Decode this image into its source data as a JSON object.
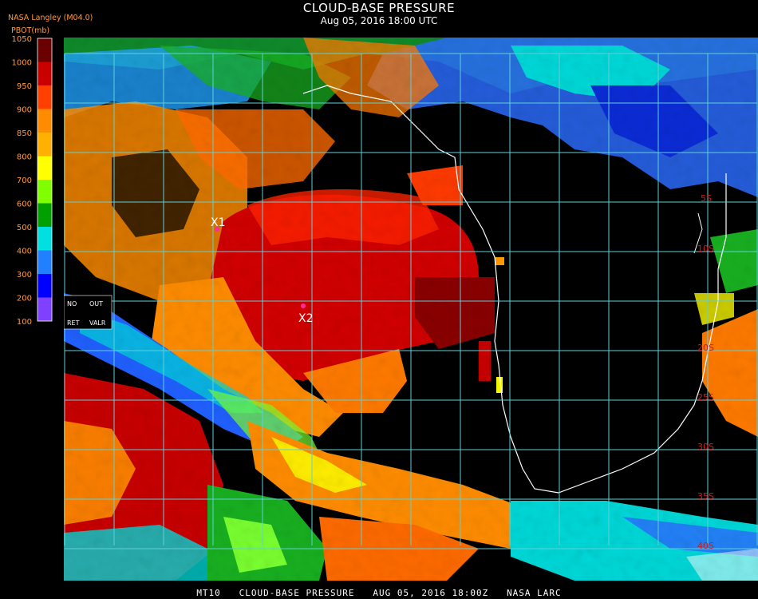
{
  "header": {
    "title": "CLOUD-BASE PRESSURE",
    "subtitle": "Aug 05, 2016 18:00 UTC",
    "source": "NASA Langley (M04.0)",
    "units": "PBOT(mb)"
  },
  "legend": {
    "labels": [
      "1050",
      "1000",
      "950",
      "900",
      "850",
      "800",
      "700",
      "600",
      "500",
      "400",
      "300",
      "200",
      "100"
    ],
    "colors": [
      "#6b0000",
      "#c80000",
      "#ff4000",
      "#ff8c00",
      "#ffb000",
      "#ffff00",
      "#80ff00",
      "#00a000",
      "#00e0e0",
      "#2080ff",
      "#0000ff",
      "#8040ff"
    ]
  },
  "key": {
    "no": "NO",
    "out": "OUT",
    "ret": "RET",
    "valr": "VALR"
  },
  "map": {
    "latitude_labels": [
      "5S",
      "10S",
      "20S",
      "25S",
      "30S",
      "35S",
      "40S"
    ],
    "markers": [
      {
        "label": "X1"
      },
      {
        "label": "X2"
      }
    ]
  },
  "footer": {
    "caption": "MT10   CLOUD-BASE PRESSURE   AUG 05, 2016 18:00Z   NASA LARC"
  },
  "colors": {
    "grid": "#5fd0d8",
    "coastline": "#ffffff",
    "marker": "#ff2aa0"
  }
}
